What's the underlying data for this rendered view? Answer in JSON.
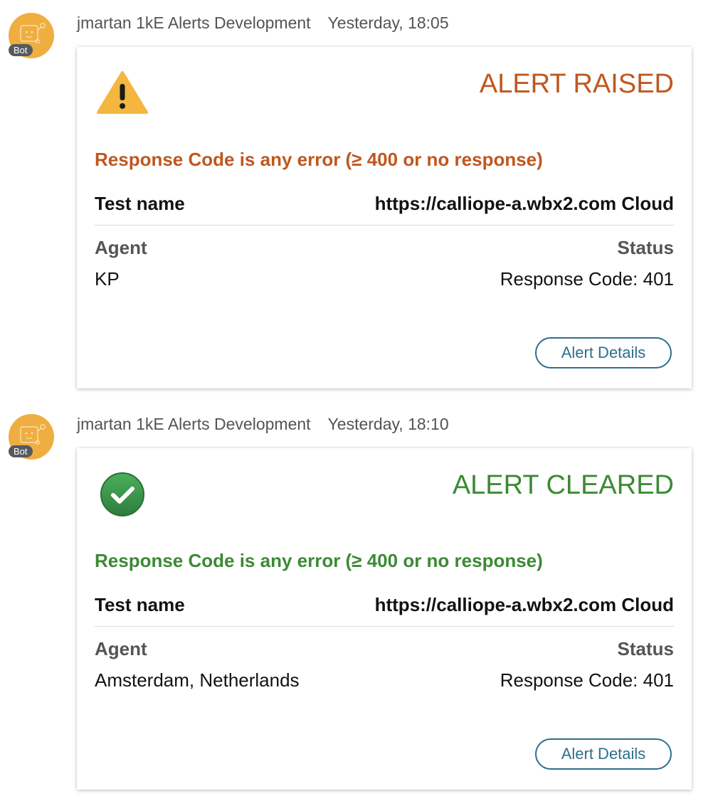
{
  "colors": {
    "raised": "#C0571F",
    "cleared": "#3C8A34",
    "button": "#2E6F8C",
    "avatar": "#F0AE40"
  },
  "messages": [
    {
      "avatar_icon": "bot-face-icon",
      "badge": "Bot",
      "sender": "jmartan 1kE Alerts Development",
      "time": "Yesterday, 18:05",
      "card": {
        "status_icon": "warning-triangle-icon",
        "title": "ALERT RAISED",
        "condition": "Response Code is any error (≥ 400 or no response)",
        "test_label": "Test name",
        "test_value": "https://calliope-a.wbx2.com Cloud",
        "agent_header": "Agent",
        "status_header": "Status",
        "agent_value": "KP",
        "status_value": "Response Code: 401",
        "button_label": "Alert Details"
      }
    },
    {
      "avatar_icon": "bot-face-icon",
      "badge": "Bot",
      "sender": "jmartan 1kE Alerts Development",
      "time": "Yesterday, 18:10",
      "card": {
        "status_icon": "check-circle-icon",
        "title": "ALERT CLEARED",
        "condition": "Response Code is any error (≥ 400 or no response)",
        "test_label": "Test name",
        "test_value": "https://calliope-a.wbx2.com Cloud",
        "agent_header": "Agent",
        "status_header": "Status",
        "agent_value": "Amsterdam, Netherlands",
        "status_value": "Response Code: 401",
        "button_label": "Alert Details"
      }
    }
  ]
}
